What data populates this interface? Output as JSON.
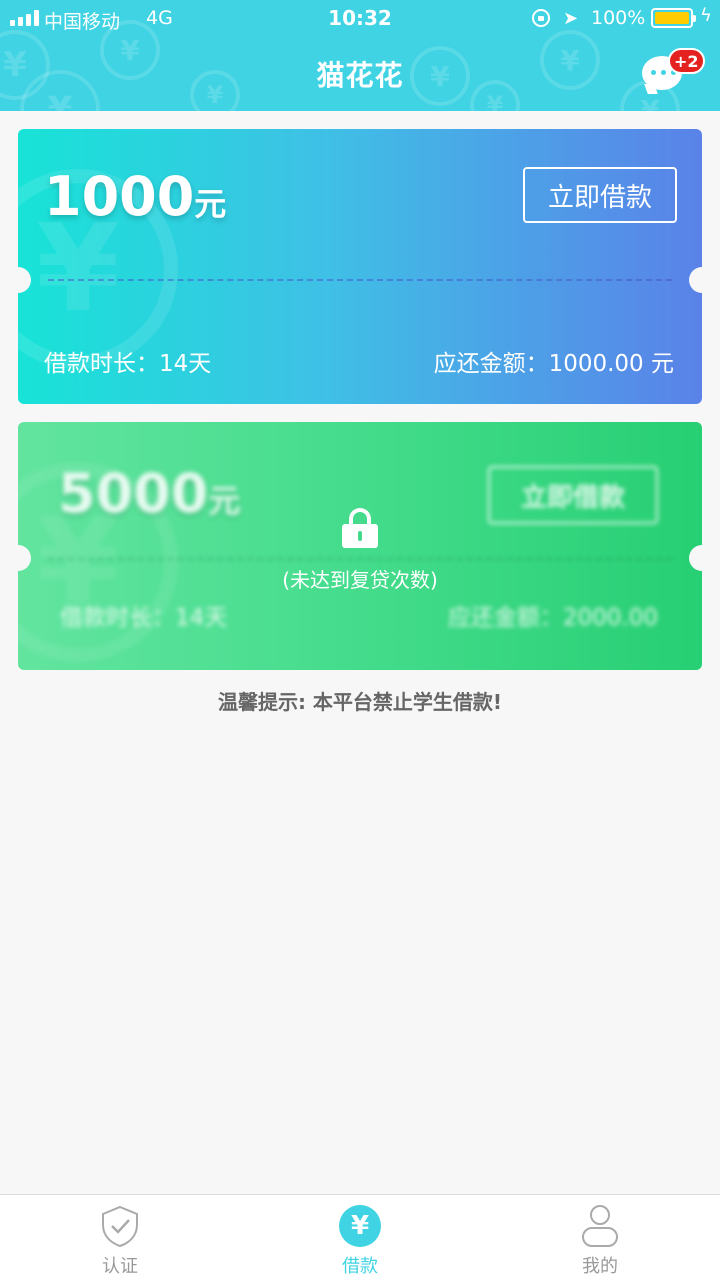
{
  "status_bar": {
    "carrier": "中国移动",
    "network": "4G",
    "time": "10:32",
    "battery": "100%",
    "battery_color": "#ffcc00"
  },
  "header": {
    "title": "猫花花",
    "message_badge": "+2",
    "color": "#3fd3e3"
  },
  "loans": [
    {
      "amount": "1000",
      "unit": "元",
      "button": "立即借款",
      "duration": "借款时长：14天",
      "repay": "应还金额：1000.00 元",
      "locked": false
    },
    {
      "amount": "5000",
      "unit": "元",
      "button": "立即借款",
      "duration": "借款时长：14天",
      "repay": "应还金额：2000.00",
      "locked": true,
      "lock_text": "(未达到复贷次数)"
    }
  ],
  "tip": "温馨提示: 本平台禁止学生借款!",
  "tabs": [
    {
      "label": "认证",
      "icon": "shield-check-icon",
      "active": false
    },
    {
      "label": "借款",
      "icon": "yen-icon",
      "active": true
    },
    {
      "label": "我的",
      "icon": "user-icon",
      "active": false
    }
  ],
  "icons": {
    "yen": "¥"
  }
}
